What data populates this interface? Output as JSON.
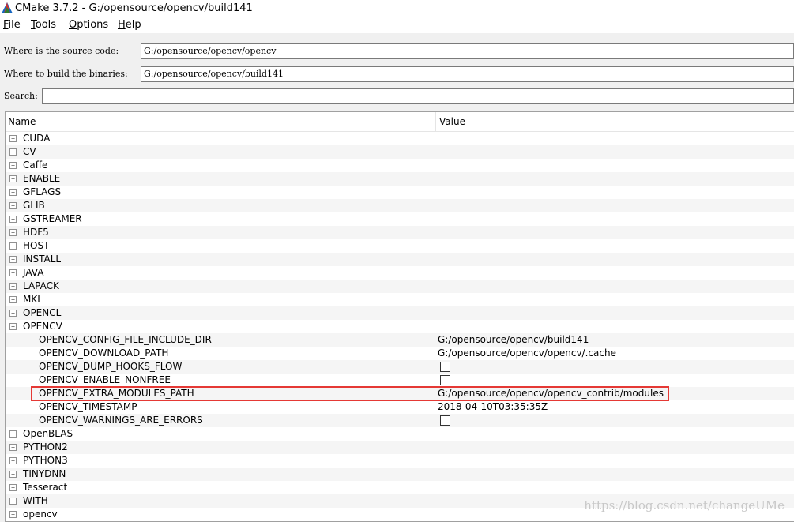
{
  "window": {
    "title": "CMake 3.7.2 - G:/opensource/opencv/build141"
  },
  "menu": [
    {
      "label": "File",
      "ul": "F",
      "rest": "ile"
    },
    {
      "label": "Tools",
      "ul": "T",
      "rest": "ools"
    },
    {
      "label": "Options",
      "ul": "O",
      "rest": "ptions"
    },
    {
      "label": "Help",
      "ul": "H",
      "rest": "elp"
    }
  ],
  "source": {
    "label": "Where is the source code:",
    "value": "G:/opensource/opencv/opencv"
  },
  "binaries": {
    "label": "Where to build the binaries:",
    "value": "G:/opensource/opencv/build141"
  },
  "search": {
    "label": "Search:",
    "value": ""
  },
  "tree": {
    "header": {
      "name": "Name",
      "value": "Value"
    },
    "rows": [
      {
        "type": "group",
        "expanded": false,
        "name": "CUDA"
      },
      {
        "type": "group",
        "expanded": false,
        "name": "CV"
      },
      {
        "type": "group",
        "expanded": false,
        "name": "Caffe"
      },
      {
        "type": "group",
        "expanded": false,
        "name": "ENABLE"
      },
      {
        "type": "group",
        "expanded": false,
        "name": "GFLAGS"
      },
      {
        "type": "group",
        "expanded": false,
        "name": "GLIB"
      },
      {
        "type": "group",
        "expanded": false,
        "name": "GSTREAMER"
      },
      {
        "type": "group",
        "expanded": false,
        "name": "HDF5"
      },
      {
        "type": "group",
        "expanded": false,
        "name": "HOST"
      },
      {
        "type": "group",
        "expanded": false,
        "name": "INSTALL"
      },
      {
        "type": "group",
        "expanded": false,
        "name": "JAVA"
      },
      {
        "type": "group",
        "expanded": false,
        "name": "LAPACK"
      },
      {
        "type": "group",
        "expanded": false,
        "name": "MKL"
      },
      {
        "type": "group",
        "expanded": false,
        "name": "OPENCL"
      },
      {
        "type": "group",
        "expanded": true,
        "name": "OPENCV"
      },
      {
        "type": "item",
        "name": "OPENCV_CONFIG_FILE_INCLUDE_DIR",
        "value": "G:/opensource/opencv/build141"
      },
      {
        "type": "item",
        "name": "OPENCV_DOWNLOAD_PATH",
        "value": "G:/opensource/opencv/opencv/.cache"
      },
      {
        "type": "item",
        "name": "OPENCV_DUMP_HOOKS_FLOW",
        "checkbox": true,
        "checked": false
      },
      {
        "type": "item",
        "name": "OPENCV_ENABLE_NONFREE",
        "checkbox": true,
        "checked": false
      },
      {
        "type": "item",
        "name": "OPENCV_EXTRA_MODULES_PATH",
        "value": "G:/opensource/opencv/opencv_contrib/modules",
        "highlighted": true
      },
      {
        "type": "item",
        "name": "OPENCV_TIMESTAMP",
        "value": "2018-04-10T03:35:35Z"
      },
      {
        "type": "item",
        "name": "OPENCV_WARNINGS_ARE_ERRORS",
        "checkbox": true,
        "checked": false
      },
      {
        "type": "group",
        "expanded": false,
        "name": "OpenBLAS"
      },
      {
        "type": "group",
        "expanded": false,
        "name": "PYTHON2"
      },
      {
        "type": "group",
        "expanded": false,
        "name": "PYTHON3"
      },
      {
        "type": "group",
        "expanded": false,
        "name": "TINYDNN"
      },
      {
        "type": "group",
        "expanded": false,
        "name": "Tesseract"
      },
      {
        "type": "group",
        "expanded": false,
        "name": "WITH"
      },
      {
        "type": "group",
        "expanded": false,
        "name": "opencv"
      }
    ]
  },
  "watermark": "https://blog.csdn.net/changeUMe",
  "colors": {
    "highlight": "#e53935",
    "row_alt": "#f5f5f5"
  }
}
